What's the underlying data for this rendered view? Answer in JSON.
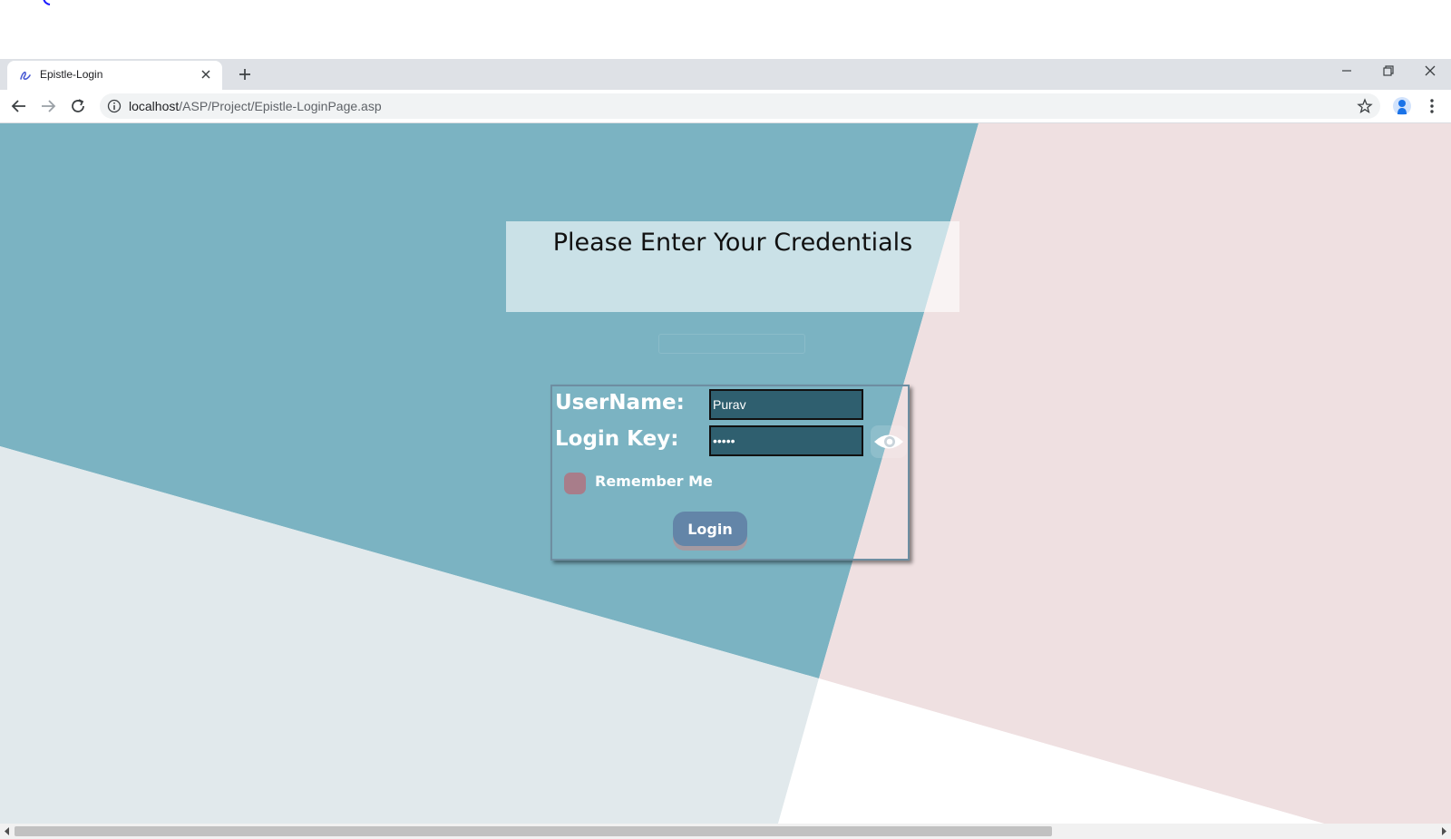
{
  "browser": {
    "tab_title": "Epistle-Login",
    "url_host": "localhost",
    "url_path": "/ASP/Project/Epistle-LoginPage.asp",
    "icons": {
      "tab": "epistle-logo-icon",
      "close": "close-icon",
      "new_tab": "plus-icon",
      "back": "back-arrow-icon",
      "forward": "forward-arrow-icon",
      "reload": "reload-icon",
      "info": "info-icon",
      "bookmark": "star-icon",
      "profile": "profile-icon",
      "menu": "more-vert-icon",
      "minimize": "minimize-icon",
      "restore": "restore-icon",
      "window_close": "window-close-icon"
    }
  },
  "page": {
    "heading": "Please Enter Your Credentials",
    "username_label": "UserName:",
    "username_value": "Purav",
    "loginkey_label": "Login Key:",
    "loginkey_value": "•••••",
    "remember_label": "Remember Me",
    "login_button": "Login",
    "eye_icon": "eye-icon"
  },
  "colors": {
    "teal_bg": "#7bb3c2",
    "pink_bg": "#efe0e1",
    "light_bg": "#e1e9ec",
    "input_bg": "#2f5f6f",
    "checkbox": "#a87d8a",
    "button": "#6385a8"
  }
}
